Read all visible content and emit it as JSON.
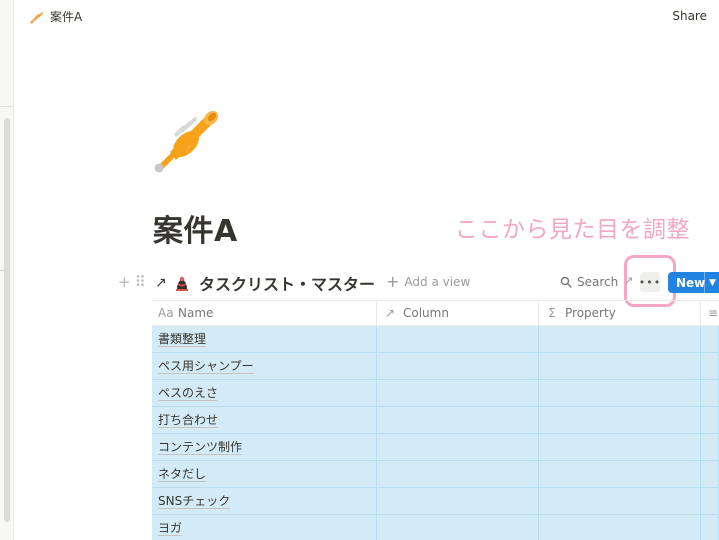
{
  "topbar": {
    "breadcrumb_title": "案件A",
    "breadcrumb_icon": "trumpet-icon",
    "share_label": "Share"
  },
  "page": {
    "icon": "trumpet-icon",
    "title": "案件A"
  },
  "annotation": {
    "text": "ここから見た目を調整",
    "color": "#f2a7c6"
  },
  "database": {
    "title": "タスクリスト・マスター",
    "link_icon": "↗",
    "icon": "chess-icon",
    "add_view_label": "Add a view",
    "search_label": "Search",
    "more_label": "•••",
    "new_label": "New",
    "accent_color": "#2383e2",
    "columns": [
      {
        "label": "Name",
        "icon": "Aa"
      },
      {
        "label": "Column",
        "icon": "↗"
      },
      {
        "label": "Property",
        "icon": "Σ"
      },
      {
        "label": "",
        "icon": "≡"
      }
    ],
    "rows": [
      "書類整理",
      "ペス用シャンプー",
      "ペスのえさ",
      "打ち合わせ",
      "コンテンツ制作",
      "ネタだし",
      "SNSチェック",
      "ヨガ"
    ],
    "row_color": "#d3ebf7"
  }
}
